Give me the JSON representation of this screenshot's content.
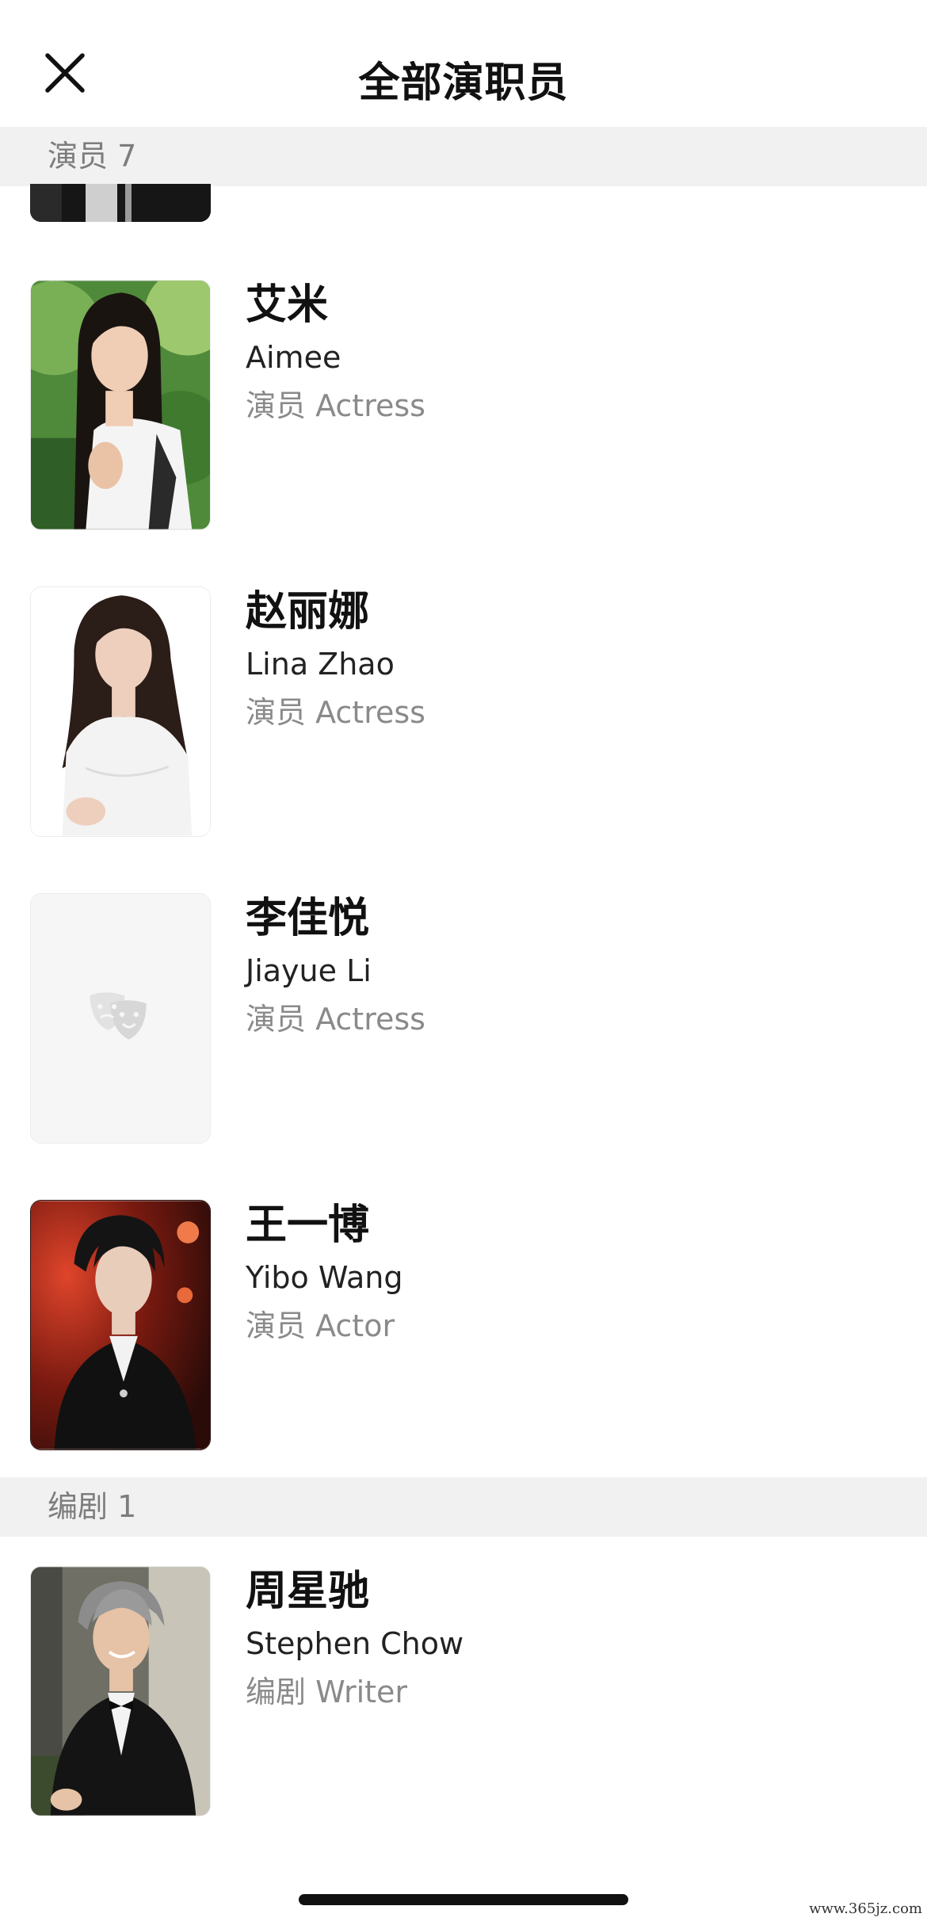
{
  "header": {
    "title": "全部演职员",
    "close_icon": "close-icon"
  },
  "sections": [
    {
      "label": "演员 7"
    },
    {
      "label": "编剧 1"
    }
  ],
  "cast": [
    {
      "name_cn": "艾米",
      "name_en": "Aimee",
      "role": "演员 Actress",
      "photo": "actress-photo-garden"
    },
    {
      "name_cn": "赵丽娜",
      "name_en": "Lina Zhao",
      "role": "演员 Actress",
      "photo": "actress-photo-white-dress"
    },
    {
      "name_cn": "李佳悦",
      "name_en": "Jiayue Li",
      "role": "演员 Actress",
      "photo": "placeholder-theater-mask-icon"
    },
    {
      "name_cn": "王一博",
      "name_en": "Yibo Wang",
      "role": "演员 Actor",
      "photo": "actor-photo-black-suit"
    }
  ],
  "writers": [
    {
      "name_cn": "周星驰",
      "name_en": "Stephen Chow",
      "role": "编剧 Writer",
      "photo": "writer-photo-tuxedo"
    }
  ],
  "watermark": "www.365jz.com",
  "colors": {
    "section_bg": "#f1f1f1",
    "secondary_text": "#8a8a8a",
    "primary_text": "#111111"
  }
}
